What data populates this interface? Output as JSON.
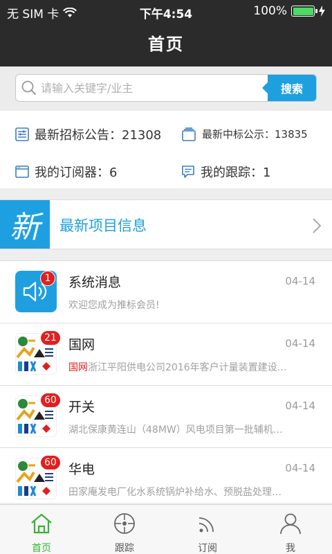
{
  "status_bar": {
    "carrier": "无 SIM 卡",
    "time": "下午4:54",
    "battery": "100%"
  },
  "header": {
    "title": "首页"
  },
  "search": {
    "placeholder": "请输入关键字/业主",
    "button": "搜索"
  },
  "stats": {
    "tender_label": "最新招标公告：21308",
    "award_label": "最新中标公示：13835",
    "subscriber_label": "我的订阅器：6",
    "tracking_label": "我的跟踪：1"
  },
  "banner": {
    "badge_char": "新",
    "label": "最新项目信息"
  },
  "messages": [
    {
      "name": "系统消息",
      "date": "04-14",
      "badge": "1",
      "desc_prefix": "",
      "desc": "欢迎您成为推标会员!"
    },
    {
      "name": "国网",
      "date": "04-14",
      "badge": "21",
      "desc_prefix": "国网",
      "desc": "浙江平阳供电公司2016年客户计量装置建设…"
    },
    {
      "name": "开关",
      "date": "04-14",
      "badge": "60",
      "desc_prefix": "",
      "desc": "湖北保康黄连山（48MW）风电项目第一批辅机…"
    },
    {
      "name": "华电",
      "date": "04-14",
      "badge": "60",
      "desc_prefix": "",
      "desc": "田家庵发电厂化水系统锅炉补给水、预脱盐处理…"
    }
  ],
  "tabs": [
    {
      "label": "首页",
      "active": true
    },
    {
      "label": "跟踪",
      "active": false
    },
    {
      "label": "订阅",
      "active": false
    },
    {
      "label": "我",
      "active": false
    }
  ],
  "colors": {
    "accent": "#1ea0e0",
    "active_tab": "#36b336",
    "badge": "#e02020",
    "header_bg": "#2b2b2b"
  }
}
